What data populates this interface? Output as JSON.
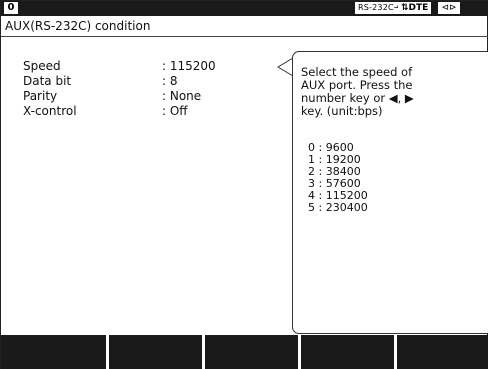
{
  "status": {
    "screen_number": "0",
    "interface": "RS-232C",
    "mode": "DTE",
    "port_icon": "connector-icon"
  },
  "title": "AUX(RS-232C) condition",
  "settings": [
    {
      "label": "Speed",
      "value": ": 115200"
    },
    {
      "label": "Data bit",
      "value": ": 8"
    },
    {
      "label": "Parity",
      "value": ": None"
    },
    {
      "label": "X-control",
      "value": ": Off"
    }
  ],
  "help": {
    "lines": [
      "Select the speed of",
      "AUX port. Press the",
      "number key or ◀, ▶",
      "key. (unit:bps)"
    ],
    "options": [
      "0 : 9600",
      "1 : 19200",
      "2 : 38400",
      "3 : 57600",
      "4 : 115200",
      "5 : 230400"
    ]
  },
  "function_keys": [
    "",
    "",
    "",
    "",
    ""
  ]
}
